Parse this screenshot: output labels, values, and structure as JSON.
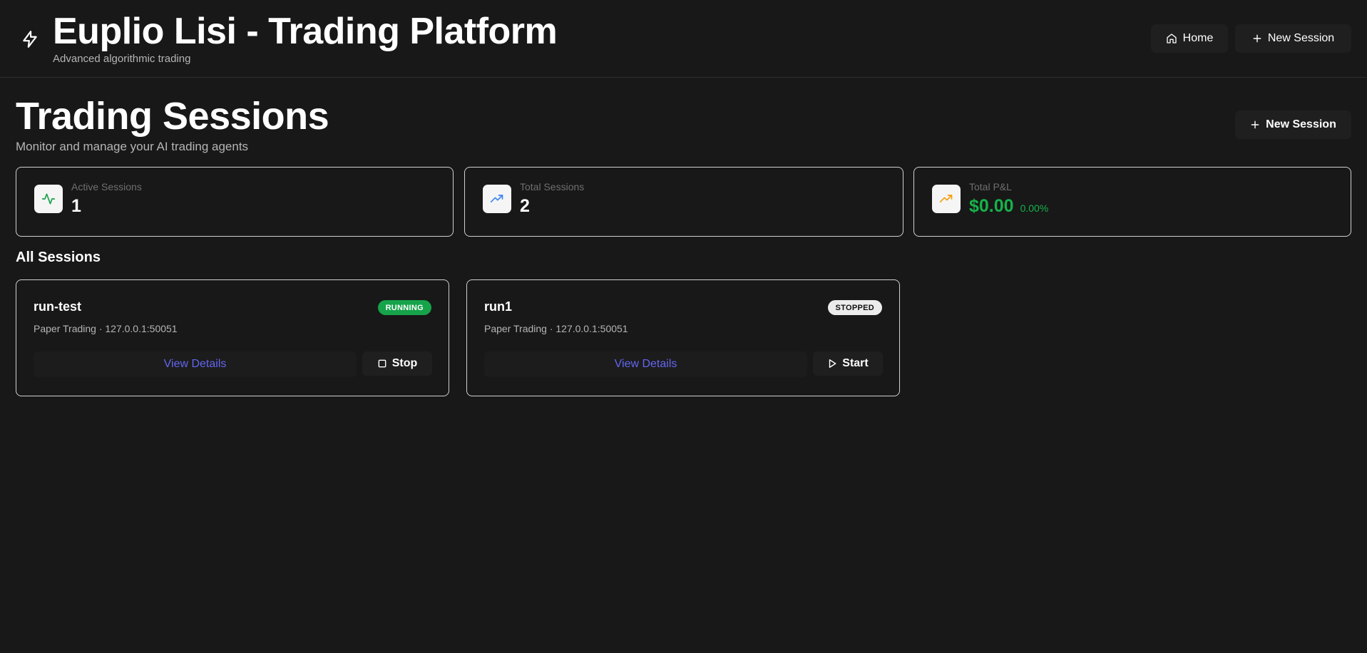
{
  "header": {
    "title": "Euplio Lisi - Trading Platform",
    "subtitle": "Advanced algorithmic trading",
    "brand_icon": "lightning-icon",
    "nav": {
      "home_label": "Home",
      "new_session_label": "New Session"
    }
  },
  "page": {
    "title": "Trading Sessions",
    "subtitle": "Monitor and manage your AI trading agents",
    "new_session_label": "New Session"
  },
  "stats": [
    {
      "label": "Active Sessions",
      "value": "1",
      "icon": "activity-icon",
      "icon_color": "#16a34a"
    },
    {
      "label": "Total Sessions",
      "value": "2",
      "icon": "trending-up-icon",
      "icon_color": "#3b82f6"
    },
    {
      "label": "Total P&L",
      "value": "$0.00",
      "change": "0.00%",
      "icon": "trending-up-icon",
      "icon_color": "#f59e0b",
      "value_color": "#16b24a"
    }
  ],
  "sessions_section": {
    "title": "All Sessions",
    "sessions": [
      {
        "name": "run-test",
        "status": "RUNNING",
        "meta": "Paper Trading · 127.0.0.1:50051",
        "details_label": "View Details",
        "action_label": "Stop",
        "action_icon": "square-icon"
      },
      {
        "name": "run1",
        "status": "STOPPED",
        "meta": "Paper Trading · 127.0.0.1:50051",
        "details_label": "View Details",
        "action_label": "Start",
        "action_icon": "play-icon"
      }
    ]
  },
  "colors": {
    "background": "#181818",
    "accent_link": "#6366f1",
    "running": "#16a34a",
    "profit": "#16b24a"
  }
}
